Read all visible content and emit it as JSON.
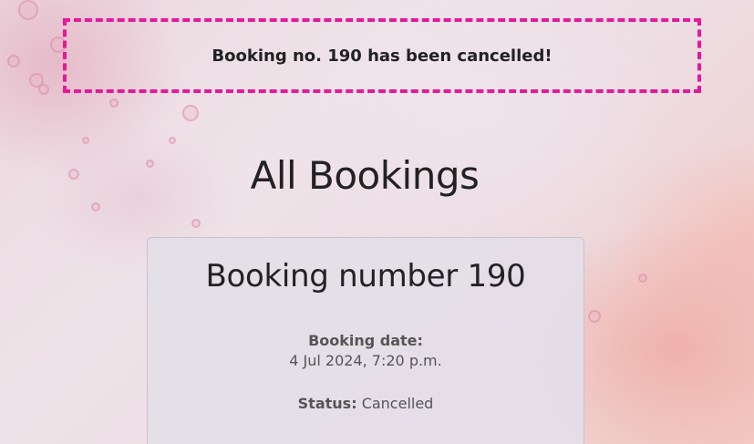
{
  "alert": {
    "message": "Booking no. 190 has been cancelled!",
    "border_color": "#e5199a"
  },
  "page": {
    "title": "All Bookings"
  },
  "booking": {
    "title": "Booking number 190",
    "date_label": "Booking date:",
    "date_value": "4 Jul 2024, 7:20 p.m.",
    "status_label": "Status:",
    "status_value": "Cancelled"
  }
}
